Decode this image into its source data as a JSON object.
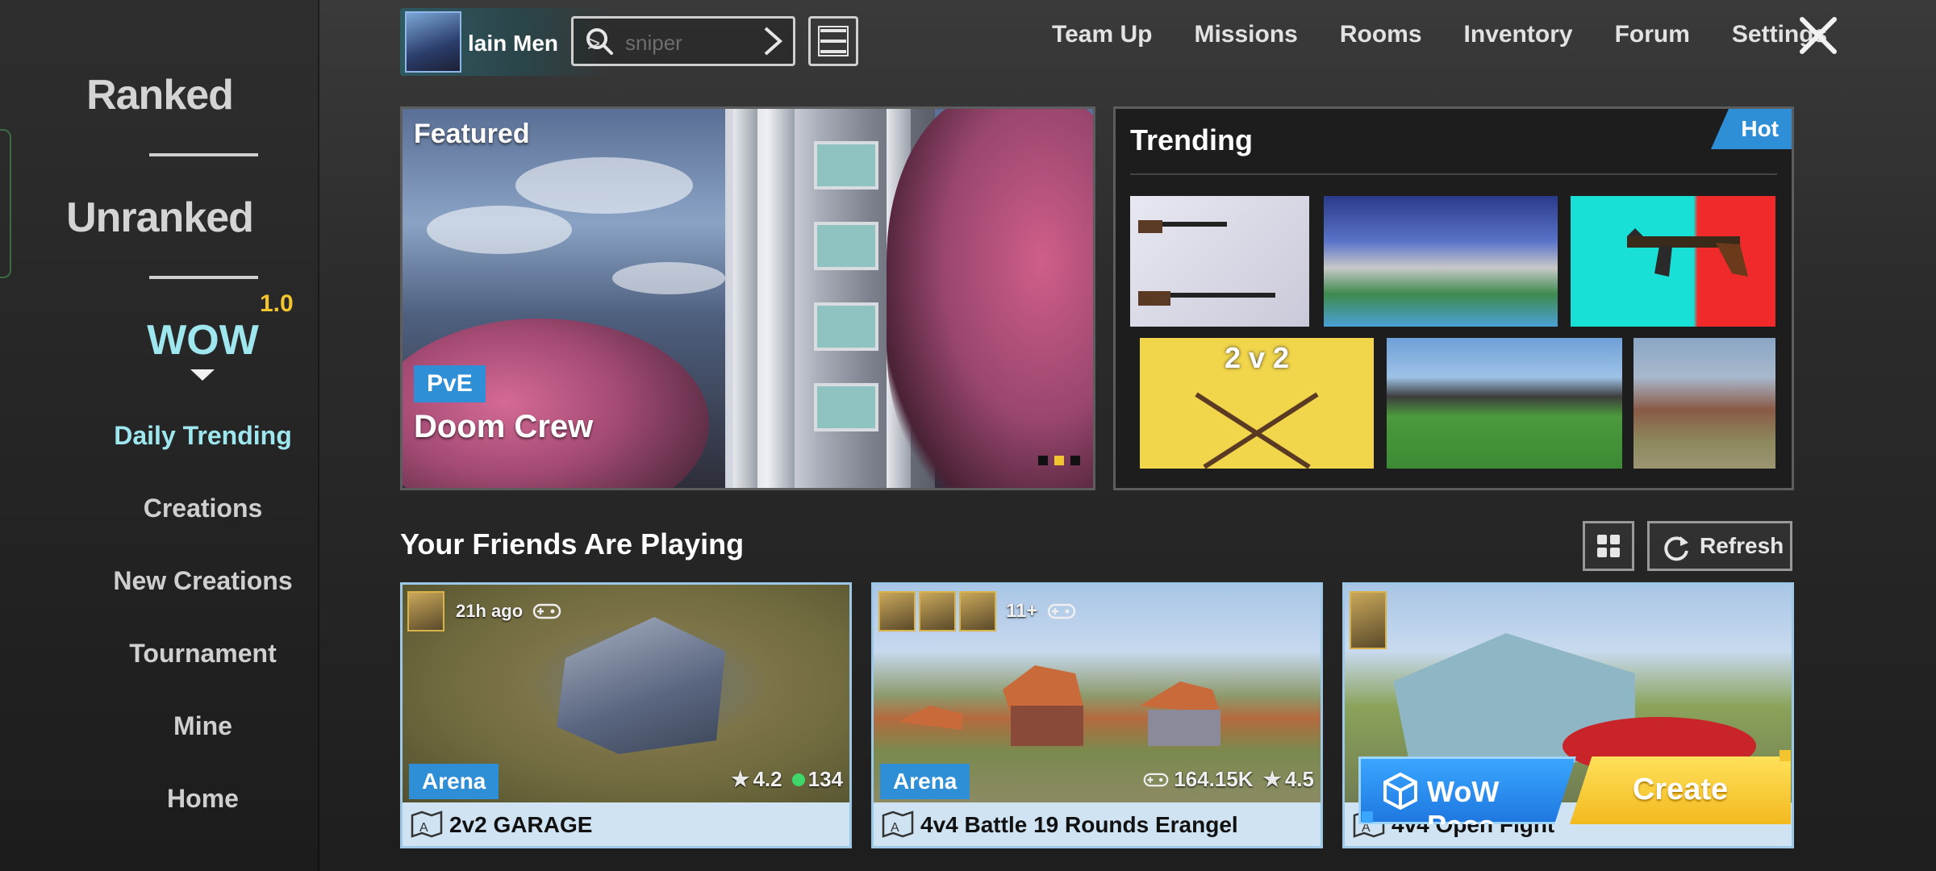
{
  "sidebar": {
    "modes": [
      "Ranked",
      "Unranked"
    ],
    "wow": {
      "title": "WOW",
      "version": "1.0"
    },
    "items": [
      {
        "label": "Daily Trending",
        "active": true
      },
      {
        "label": "Creations",
        "active": false
      },
      {
        "label": "New Creations",
        "active": false
      },
      {
        "label": "Tournament",
        "active": false
      },
      {
        "label": "Mine",
        "active": false
      },
      {
        "label": "Home",
        "active": false
      }
    ]
  },
  "topbar": {
    "profile_name": "lain Men",
    "search_placeholder": "sniper",
    "links": [
      "Team Up",
      "Missions",
      "Rooms",
      "Inventory",
      "Forum",
      "Settings"
    ]
  },
  "featured": {
    "title": "Featured",
    "tag": "PvE",
    "name": "Doom Crew",
    "slides": 3,
    "active_slide": 2
  },
  "trending": {
    "title": "Trending",
    "badge": "Hot",
    "tiles": [
      {
        "label": ""
      },
      {
        "label": ""
      },
      {
        "label": ""
      },
      {
        "label": "2 v 2"
      },
      {
        "label": ""
      },
      {
        "label": ""
      }
    ]
  },
  "friends": {
    "title": "Your Friends Are Playing",
    "refresh_label": "Refresh",
    "cards": [
      {
        "time": "21h ago",
        "tag": "Arena",
        "rating": "4.2",
        "online": "134",
        "name": "2v2 GARAGE"
      },
      {
        "extra": "11+",
        "tag": "Arena",
        "plays": "164.15K",
        "rating": "4.5",
        "name": "4v4 Battle 19 Rounds Erangel"
      },
      {
        "name": "4v4 Open Fight"
      }
    ]
  },
  "actions": {
    "wow_pass": "WoW Pass",
    "create": "Create"
  },
  "colors": {
    "accent_blue": "#2f8fd6",
    "accent_yellow": "#f2c530",
    "active_nav": "#9fe7ee"
  }
}
